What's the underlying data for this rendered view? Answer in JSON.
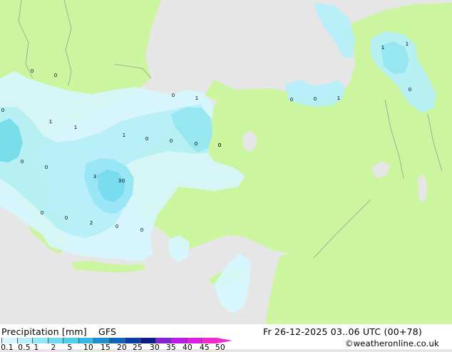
{
  "legend": {
    "title": "Precipitation [mm]",
    "model": "GFS",
    "ticks": [
      "0.1",
      "0.5",
      "1",
      "2",
      "5",
      "10",
      "15",
      "20",
      "25",
      "30",
      "35",
      "40",
      "45",
      "50"
    ],
    "colors": [
      "#d6f7ff",
      "#b4f0fc",
      "#91e6f8",
      "#6fdbf2",
      "#4fcfee",
      "#35b9e3",
      "#1e90d2",
      "#0f65bb",
      "#0a3ea3",
      "#0a1f8a",
      "#8a1fd8",
      "#b81ee6",
      "#de1ee0",
      "#f02ad0"
    ]
  },
  "valid_time": "Fr 26-12-2025 03..06 UTC (00+78)",
  "credit": "©weatheronline.co.uk",
  "map": {
    "sea_color": "#e6e6e6",
    "land_color": "#ccf5a0",
    "precip_light": "#d6f7ff",
    "precip_mid": "#b4f0fc",
    "precip_strong": "#91e6f8",
    "precip_heavy": "#6fdbf2",
    "labels": [
      "0",
      "0",
      "0",
      "0",
      "1",
      "1",
      "1",
      "0",
      "0",
      "0",
      "0",
      "1",
      "0",
      "0",
      "3",
      "3",
      "0",
      "0",
      "2",
      "0",
      "0",
      "0",
      "0",
      "1",
      "0",
      "1",
      "0",
      "1",
      "0"
    ]
  }
}
